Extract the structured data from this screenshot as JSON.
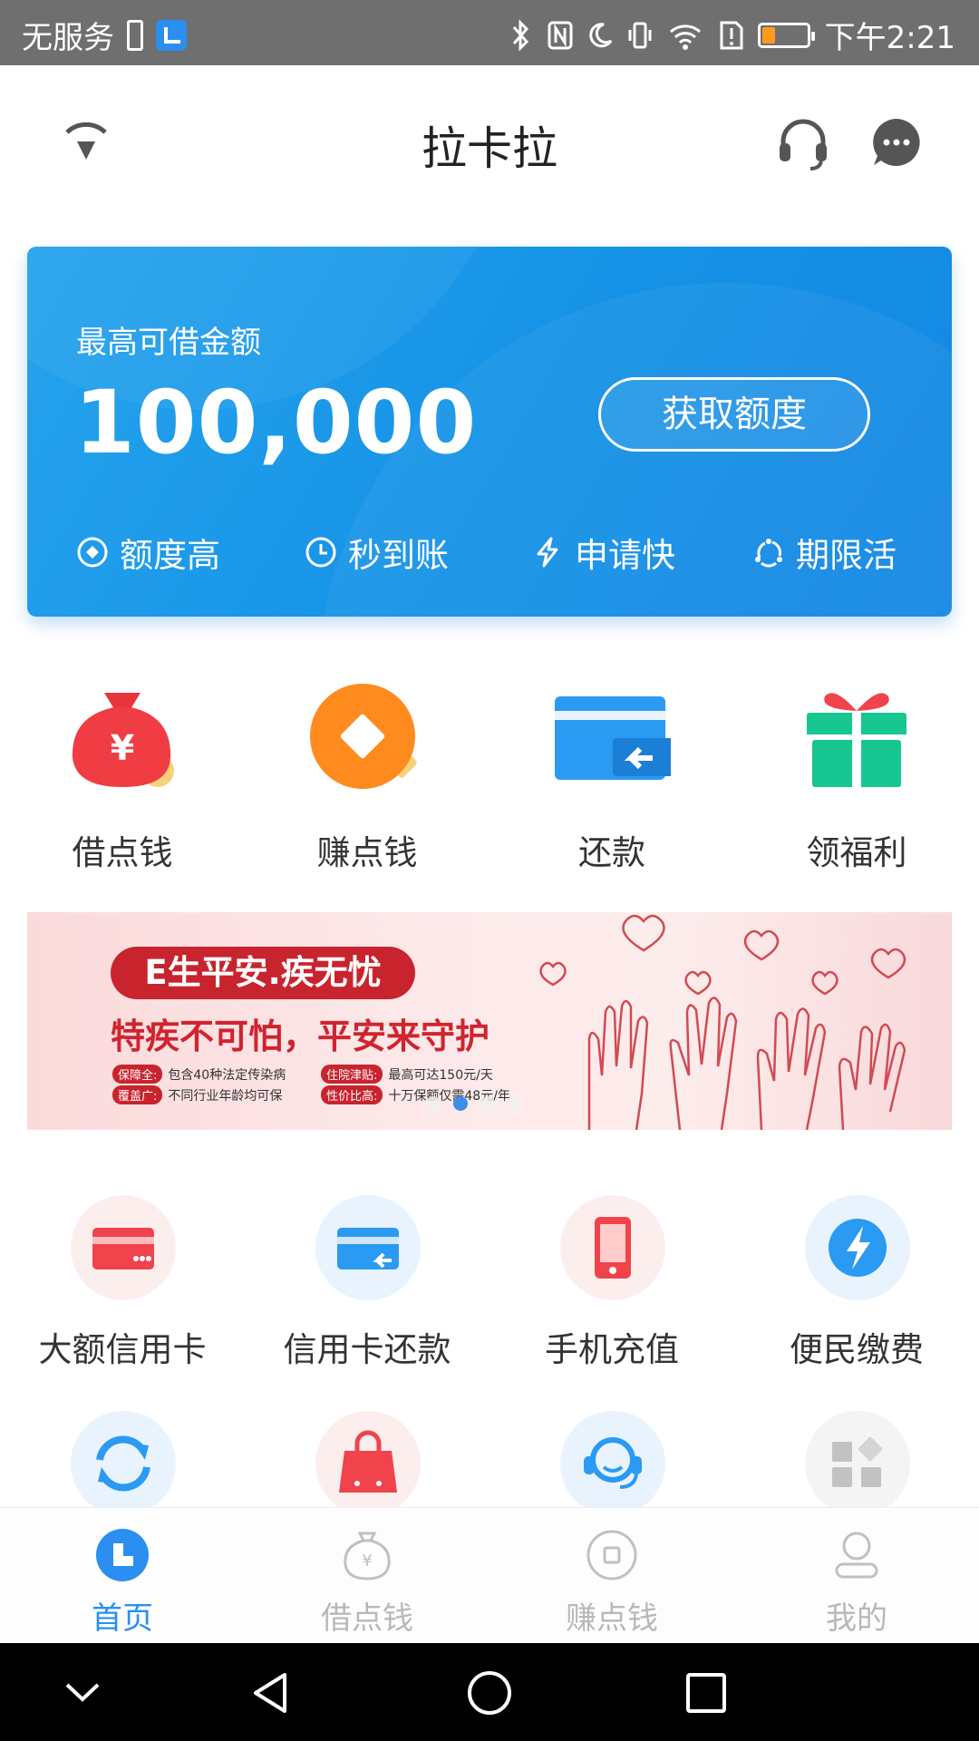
{
  "status_bar": {
    "carrier": "无服务",
    "time": "下午2:21",
    "battery_level_fraction": 0.15,
    "icons": [
      "sim-icon",
      "app-icon",
      "bluetooth-icon",
      "nfc-icon",
      "moon-icon",
      "vibrate-icon",
      "wifi-icon",
      "sd-alert-icon",
      "battery-icon"
    ]
  },
  "header": {
    "title": "拉卡拉",
    "left_icon": "signal-icon",
    "right_icons": [
      "headset-icon",
      "message-icon"
    ]
  },
  "credit_card": {
    "label": "最高可借金额",
    "amount": "100,000",
    "button": "获取额度",
    "features": [
      {
        "icon": "target-icon",
        "label": "额度高"
      },
      {
        "icon": "clock-icon",
        "label": "秒到账"
      },
      {
        "icon": "lightning-icon",
        "label": "申请快"
      },
      {
        "icon": "cycle-icon",
        "label": "期限活"
      }
    ],
    "colors": {
      "start": "#26a3ec",
      "end": "#1487e3"
    }
  },
  "quick_actions": [
    {
      "icon": "money-bag-icon",
      "label": "借点钱"
    },
    {
      "icon": "coin-icon",
      "label": "赚点钱"
    },
    {
      "icon": "card-return-icon",
      "label": "还款"
    },
    {
      "icon": "gift-icon",
      "label": "领福利"
    }
  ],
  "banner": {
    "title": "E生平安.疾无忧",
    "subtitle": "特疾不可怕，平安来守护",
    "rows": [
      {
        "tag": "保障全:",
        "text": "包含40种法定传染病"
      },
      {
        "tag": "覆盖广:",
        "text": "不同行业年龄均可保"
      },
      {
        "tag": "住院津贴:",
        "text": "最高可达150元/天"
      },
      {
        "tag": "性价比高:",
        "text": "十万保额仅需48元/年"
      }
    ],
    "carousel_active_index": 1,
    "carousel_count": 4
  },
  "services": [
    {
      "icon": "credit-card-icon",
      "label": "大额信用卡",
      "color": "#f0434b",
      "bg": "#fdeeee"
    },
    {
      "icon": "card-repay-icon",
      "label": "信用卡还款",
      "color": "#2a9af2",
      "bg": "#e8f3fd"
    },
    {
      "icon": "phone-topup-icon",
      "label": "手机充值",
      "color": "#f0434b",
      "bg": "#fdeeee"
    },
    {
      "icon": "bolt-icon",
      "label": "便民缴费",
      "color": "#2a9af2",
      "bg": "#e8f3fd"
    },
    {
      "icon": "refresh-icon",
      "label": "",
      "color": "#2a9af2",
      "bg": "#e8f3fd"
    },
    {
      "icon": "shopping-bag-icon",
      "label": "",
      "color": "#f0434b",
      "bg": "#fdeeee"
    },
    {
      "icon": "support-icon",
      "label": "",
      "color": "#2a9af2",
      "bg": "#e8f3fd"
    },
    {
      "icon": "grid-icon",
      "label": "",
      "color": "#c2c2c2",
      "bg": "#f4f4f4"
    }
  ],
  "bottom_nav": [
    {
      "icon": "home-icon",
      "label": "首页",
      "active": true
    },
    {
      "icon": "money-bag-outline-icon",
      "label": "借点钱",
      "active": false
    },
    {
      "icon": "earn-icon",
      "label": "赚点钱",
      "active": false
    },
    {
      "icon": "profile-icon",
      "label": "我的",
      "active": false
    }
  ],
  "system_nav": [
    "down-icon",
    "back-icon",
    "home-circle-icon",
    "recents-icon"
  ],
  "accent_color": "#2a8ff0"
}
